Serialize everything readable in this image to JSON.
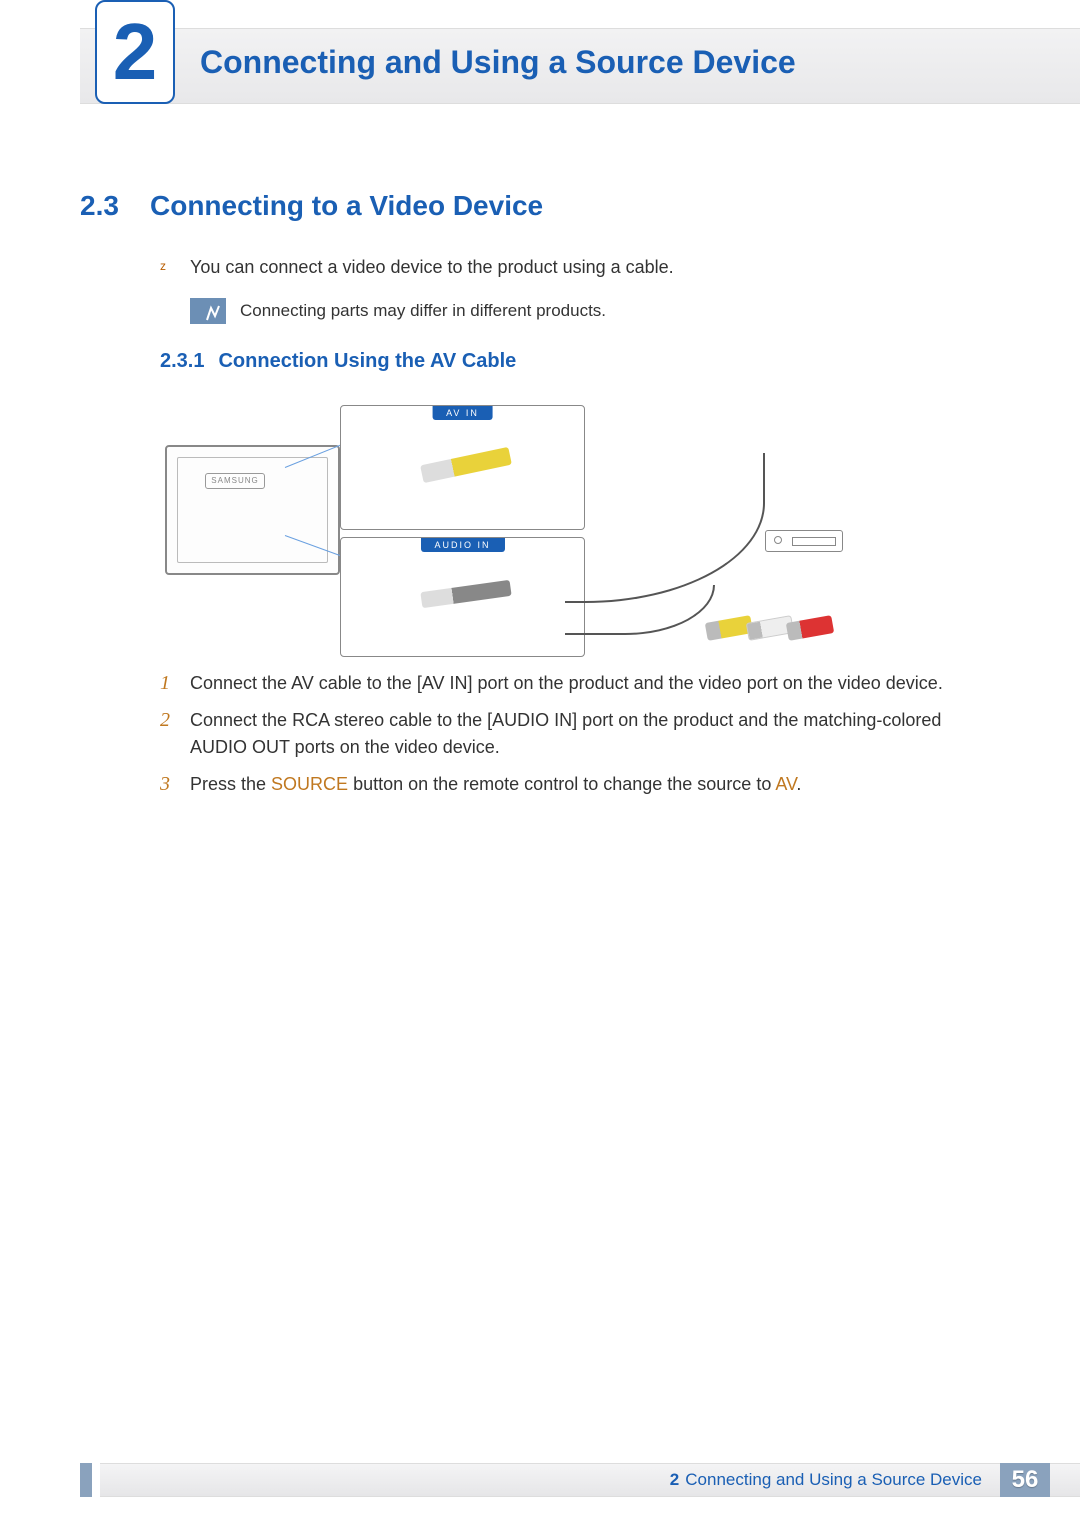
{
  "chapter": {
    "number": "2",
    "title": "Connecting and Using a Source Device"
  },
  "section": {
    "number": "2.3",
    "title": "Connecting to a Video Device"
  },
  "intro_bullet": "You can connect a video device to the product using a cable.",
  "note": "Connecting parts may differ in different products.",
  "subsection": {
    "number": "2.3.1",
    "title": "Connection Using the AV Cable"
  },
  "diagram": {
    "brand": "SAMSUNG",
    "panel_av": "AV IN",
    "panel_audio": "AUDIO IN"
  },
  "steps": [
    {
      "num": "1",
      "parts": [
        {
          "t": "Connect the AV cable to the [AV IN] port on the product and the video port on the video device."
        }
      ]
    },
    {
      "num": "2",
      "parts": [
        {
          "t": "Connect the RCA stereo cable to the [AUDIO IN] port on the product and the matching-colored AUDIO OUT ports on the video device."
        }
      ]
    },
    {
      "num": "3",
      "parts": [
        {
          "t": "Press the "
        },
        {
          "t": "SOURCE",
          "hl": true
        },
        {
          "t": " button on the remote control to change the source to "
        },
        {
          "t": "AV",
          "hl": true
        },
        {
          "t": "."
        }
      ]
    }
  ],
  "footer": {
    "chapter_num": "2",
    "chapter_title": "Connecting and Using a Source Device",
    "page": "56"
  }
}
